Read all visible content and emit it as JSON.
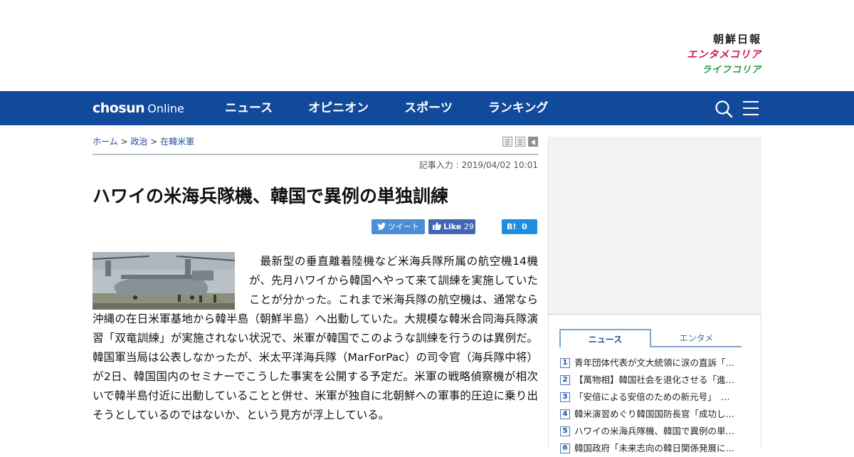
{
  "header": {
    "brand_main": "朝鮮日報",
    "brand_enta": "エンタメコリア",
    "brand_life": "ライフコリア"
  },
  "nav": {
    "logo_bold": "chosun",
    "logo_light": "Online",
    "items": [
      "ニュース",
      "オピニオン",
      "スポーツ",
      "ランキング"
    ]
  },
  "article": {
    "breadcrumb": [
      "ホーム",
      "政治",
      "在韓米軍"
    ],
    "breadcrumb_sep": ">",
    "dateline": "記事入力 : 2019/04/02 10:01",
    "title": "ハワイの米海兵隊機、韓国で異例の単独訓練",
    "share": {
      "tweet": "ツイート",
      "like": "Like",
      "like_count": "29",
      "hatena": "B!",
      "hatena_count": "0"
    },
    "body": "最新型の垂直離着陸機など米海兵隊所属の航空機14機が、先月ハワイから韓国へやって来て訓練を実施していたことが分かった。これまで米海兵隊の航空機は、通常なら沖縄の在日米軍基地から韓半島（朝鮮半島）へ出動していた。大規模な韓米合同海兵隊演習「双竜訓練」が実施されない状況で、米軍が韓国でこのような訓練を行うのは異例だ。韓国軍当局は公表しなかったが、米太平洋海兵隊（MarForPac）の司令官（海兵隊中将）が2日、韓国国内のセミナーでこうした事実を公開する予定だ。米軍の戦略偵察機が相次いで韓半島付近に出動していることと併せ、米軍が独自に北朝鮮への軍事的圧迫に乗り出そうとしているのではないか、という見方が浮上している。"
  },
  "sidebar": {
    "tabs": [
      "ニュース",
      "エンタメ"
    ],
    "ranking": [
      {
        "num": "1",
        "title": "青年団体代表が文大統領に涙の直訴「…"
      },
      {
        "num": "2",
        "title": "【萬物相】韓国社会を退化させる「進…"
      },
      {
        "num": "3",
        "title": "「安倍による安倍のための新元号」　…"
      },
      {
        "num": "4",
        "title": "韓米演習めぐり韓国国防長官「成功し…"
      },
      {
        "num": "5",
        "title": "ハワイの米海兵隊機、韓国で異例の単…"
      },
      {
        "num": "6",
        "title": "韓国政府「未来志向の韓日関係発展に…"
      }
    ]
  },
  "colors": {
    "nav_bg": "#11499b",
    "link": "#1d4f9c",
    "enta": "#c8184f",
    "life": "#2a9a45"
  }
}
